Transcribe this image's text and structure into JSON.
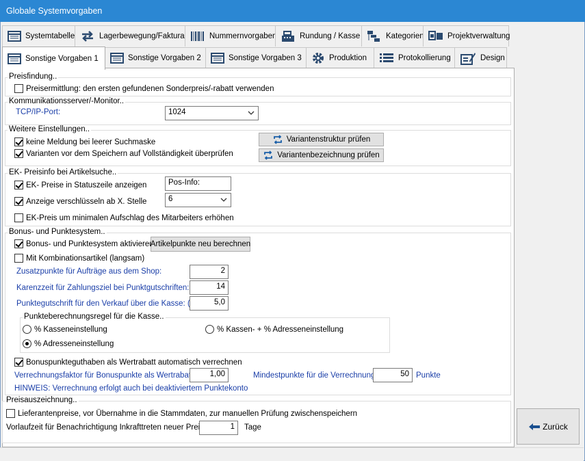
{
  "window": {
    "title": "Globale Systemvorgaben"
  },
  "tabs_row1": [
    {
      "label": "Systemtabelle",
      "icon": "table-icon"
    },
    {
      "label": "Lagerbewegung/Faktura",
      "icon": "arrows-icon"
    },
    {
      "label": "Nummernvorgaben",
      "icon": "barcode-icon"
    },
    {
      "label": "Rundung / Kasse",
      "icon": "cash-register-icon"
    },
    {
      "label": "Kategorien",
      "icon": "categories-icon"
    },
    {
      "label": "Projektverwaltung",
      "icon": "project-icon"
    }
  ],
  "tabs_row2": [
    {
      "label": "Sonstige Vorgaben 1",
      "icon": "table-icon",
      "active": true
    },
    {
      "label": "Sonstige Vorgaben 2",
      "icon": "table-icon"
    },
    {
      "label": "Sonstige Vorgaben 3",
      "icon": "table-icon"
    },
    {
      "label": "Produktion",
      "icon": "gear-icon"
    },
    {
      "label": "Protokollierung",
      "icon": "list-icon"
    },
    {
      "label": "Design",
      "icon": "design-icon"
    }
  ],
  "preisfindung": {
    "legend": "Preisfindung..",
    "preisermittlung": {
      "label": "Preisermittlung: den ersten gefundenen Sonderpreis/-rabatt verwenden",
      "checked": false
    }
  },
  "kommunikation": {
    "legend": "Kommunikationsserver/-Monitor..",
    "port_label": "TCP/IP-Port:",
    "port_value": "1024"
  },
  "weitere": {
    "legend": "Weitere Einstellungen..",
    "keine_meldung": {
      "label": "keine Meldung bei leerer Suchmaske",
      "checked": true
    },
    "varianten_pruefen": {
      "label": "Varianten vor dem Speichern auf Vollständigkeit überprüfen",
      "checked": true
    },
    "btn_struktur": "Variantenstruktur prüfen",
    "btn_bezeichnung": "Variantenbezeichnung prüfen"
  },
  "ekpreis": {
    "legend": "EK- Preisinfo bei Artikelsuche..",
    "statuszeile": {
      "label": "EK- Preise in Statuszeile anzeigen",
      "checked": true
    },
    "statuszeile_value": "Pos-Info:",
    "verschluesseln": {
      "label": "Anzeige verschlüsseln ab X. Stelle",
      "checked": true
    },
    "verschluesseln_value": "6",
    "aufschlag": {
      "label": "EK-Preis um minimalen Aufschlag des Mitarbeiters erhöhen",
      "checked": false
    }
  },
  "bonus": {
    "legend": "Bonus- und Punktesystem..",
    "aktivieren": {
      "label": "Bonus- und Punktesystem aktivieren",
      "checked": true
    },
    "btn_neuberechnen": "Artikelpunkte neu berechnen",
    "kombination": {
      "label": "Mit Kombinationsartikel (langsam)",
      "checked": false
    },
    "zusatzpunkte_label": "Zusatzpunkte für Aufträge aus dem Shop:",
    "zusatzpunkte_value": "2",
    "karenzzeit_label": "Karenzzeit für Zahlungsziel bei Punktgutschriften:",
    "karenzzeit_value": "14",
    "punktegutschrift_label": "Punktegutschrift für den Verkauf über die Kasse: (%)",
    "punktegutschrift_value": "5,0",
    "regel": {
      "legend": "Punkteberechnungsregel für die Kasse..",
      "kasseneinstellung": {
        "label": "% Kasseneinstellung",
        "checked": false
      },
      "kassen_adressen": {
        "label": "% Kassen- + % Adresseneinstellung",
        "checked": false
      },
      "adresseneinstellung": {
        "label": "% Adresseneinstellung",
        "checked": true
      }
    },
    "wertrabatt": {
      "label": "Bonuspunkteguthaben als Wertrabatt automatisch verrechnen",
      "checked": true
    },
    "faktor_label": "Verrechnungsfaktor für Bonuspunkte als Wertrabatt:",
    "faktor_value": "1,00",
    "mindest_label": "Mindestpunkte für die Verrechnung:",
    "mindest_value": "50",
    "mindest_unit": "Punkte",
    "hinweis": "HINWEIS: Verrechnung erfolgt auch bei deaktiviertem Punktekonto"
  },
  "preisauszeichnung": {
    "legend": "Preisauszeichnung..",
    "lieferantenpreise": {
      "label": "Lieferantenpreise, vor Übernahme in die Stammdaten, zur manuellen Prüfung zwischenspeichern",
      "checked": false
    },
    "vorlaufzeit_label": "Vorlaufzeit für Benachrichtigung Inkrafttreten neuer Preise:",
    "vorlaufzeit_value": "1",
    "vorlaufzeit_unit": "Tage"
  },
  "back_button": "Zurück"
}
